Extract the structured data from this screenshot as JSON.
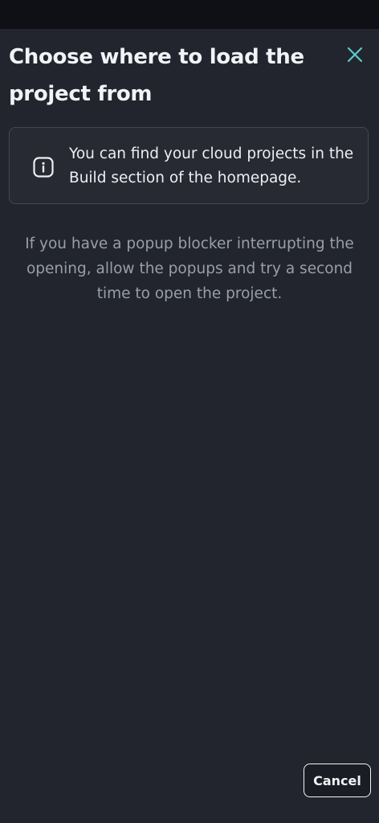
{
  "dialog": {
    "title": "Choose where to load the project from",
    "close_icon": "close-icon",
    "info": {
      "icon": "info-icon",
      "text": "You can find your cloud projects in the Build section of the homepage."
    },
    "note": "If you have a popup blocker interrupting the opening, allow the popups and try a second time to open the project.",
    "cancel_label": "Cancel"
  },
  "colors": {
    "background": "#22252e",
    "status_bar": "#0f1016",
    "accent": "#5cc9c9",
    "title": "#f2f3f7",
    "muted_text": "#9a9ea9",
    "info_border": "#434756"
  }
}
